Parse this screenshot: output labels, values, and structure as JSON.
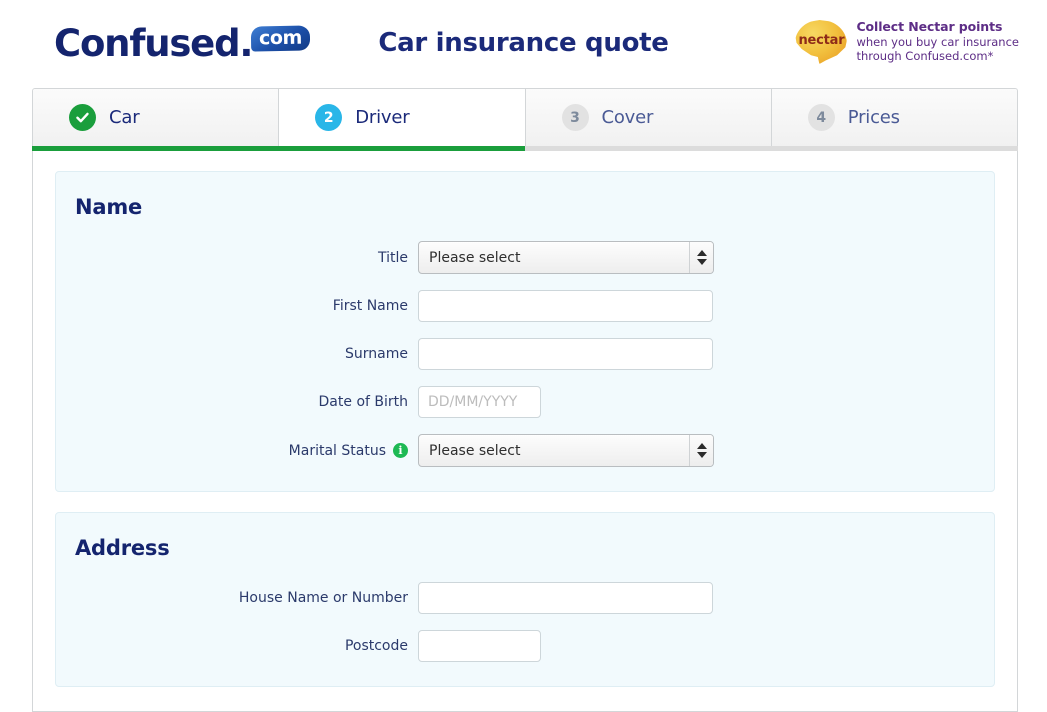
{
  "header": {
    "logo_word": "Confused.",
    "logo_badge": "com",
    "page_title": "Car insurance quote",
    "nectar": {
      "logo_text": "nectar",
      "headline": "Collect Nectar points",
      "line2": "when you buy car insurance",
      "line3": "through Confused.com*"
    }
  },
  "tabs": [
    {
      "badge": "check",
      "label": "Car",
      "state": "done"
    },
    {
      "badge": "2",
      "label": "Driver",
      "state": "current"
    },
    {
      "badge": "3",
      "label": "Cover",
      "state": "pending"
    },
    {
      "badge": "4",
      "label": "Prices",
      "state": "pending"
    }
  ],
  "progress": {
    "percent": 50
  },
  "panels": [
    {
      "title": "Name",
      "fields": [
        {
          "label": "Title",
          "type": "select",
          "value": "Please select",
          "info": false
        },
        {
          "label": "First Name",
          "type": "text",
          "value": "",
          "placeholder": "",
          "info": false
        },
        {
          "label": "Surname",
          "type": "text",
          "value": "",
          "placeholder": "",
          "info": false
        },
        {
          "label": "Date of Birth",
          "type": "text-small",
          "value": "",
          "placeholder": "DD/MM/YYYY",
          "info": false
        },
        {
          "label": "Marital Status",
          "type": "select",
          "value": "Please select",
          "info": true
        }
      ]
    },
    {
      "title": "Address",
      "fields": [
        {
          "label": "House Name or Number",
          "type": "text",
          "value": "",
          "placeholder": "",
          "info": false
        },
        {
          "label": "Postcode",
          "type": "text-small",
          "value": "",
          "placeholder": "",
          "info": false
        }
      ]
    }
  ],
  "colors": {
    "brand_navy": "#14246e",
    "accent_green": "#1a9e3c",
    "accent_blue": "#29b6e8",
    "panel_bg": "#f2fafd",
    "nectar_purple": "#5d2d86",
    "nectar_yellow": "#f2c13f"
  },
  "icons": {
    "check": "✔",
    "info": "i"
  }
}
